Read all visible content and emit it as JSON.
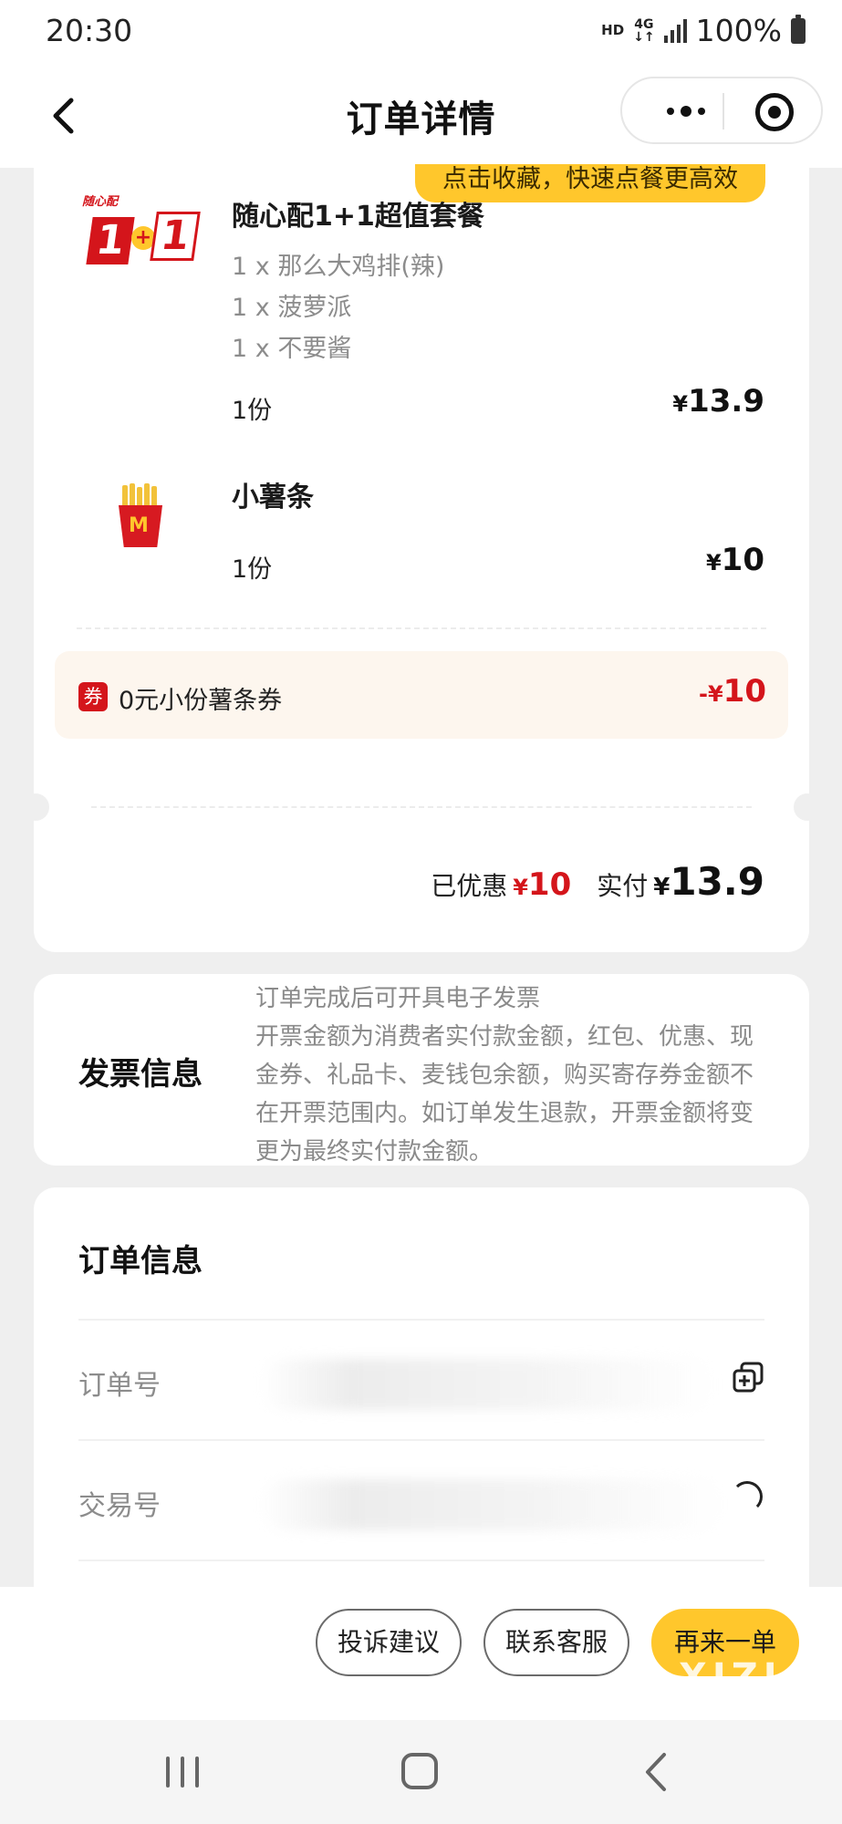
{
  "status_bar": {
    "time": "20:30",
    "hd": "HD",
    "network": "4G",
    "battery": "100%"
  },
  "nav": {
    "title": "订单详情"
  },
  "tip": "点击收藏，快速点餐更高效",
  "items": [
    {
      "name": "随心配1+1超值套餐",
      "logo_tag": "随心配",
      "options": [
        "1 x 那么大鸡排(辣)",
        "1 x 菠萝派",
        "1 x 不要酱"
      ],
      "qty": "1份",
      "currency": "¥",
      "price": "13.9"
    },
    {
      "name": "小薯条",
      "qty": "1份",
      "currency": "¥",
      "price": "10"
    }
  ],
  "coupon": {
    "badge": "券",
    "label": "0元小份薯条券",
    "sign": "-¥",
    "amount": "10"
  },
  "summary": {
    "discount_label": "已优惠",
    "discount_currency": "¥",
    "discount_amount": "10",
    "paid_label": "实付",
    "paid_currency": "¥",
    "paid_amount": "13.9"
  },
  "invoice": {
    "title": "发票信息",
    "line1": "订单完成后可开具电子发票",
    "line2": "开票金额为消费者实付款金额，红包、优惠、现金券、礼品卡、麦钱包余额，购买寄存券金额不在开票范围内。如订单发生退款，开票金额将变更为最终实付款金额。"
  },
  "order_info": {
    "title": "订单信息",
    "order_no_label": "订单号",
    "trade_no_label": "交易号"
  },
  "actions": {
    "complain": "投诉建议",
    "service": "联系客服",
    "reorder": "再来一单"
  },
  "watermark": "XIZI",
  "colors": {
    "brand_yellow": "#ffc72c",
    "brand_red": "#d4151b",
    "background": "#efefef"
  }
}
